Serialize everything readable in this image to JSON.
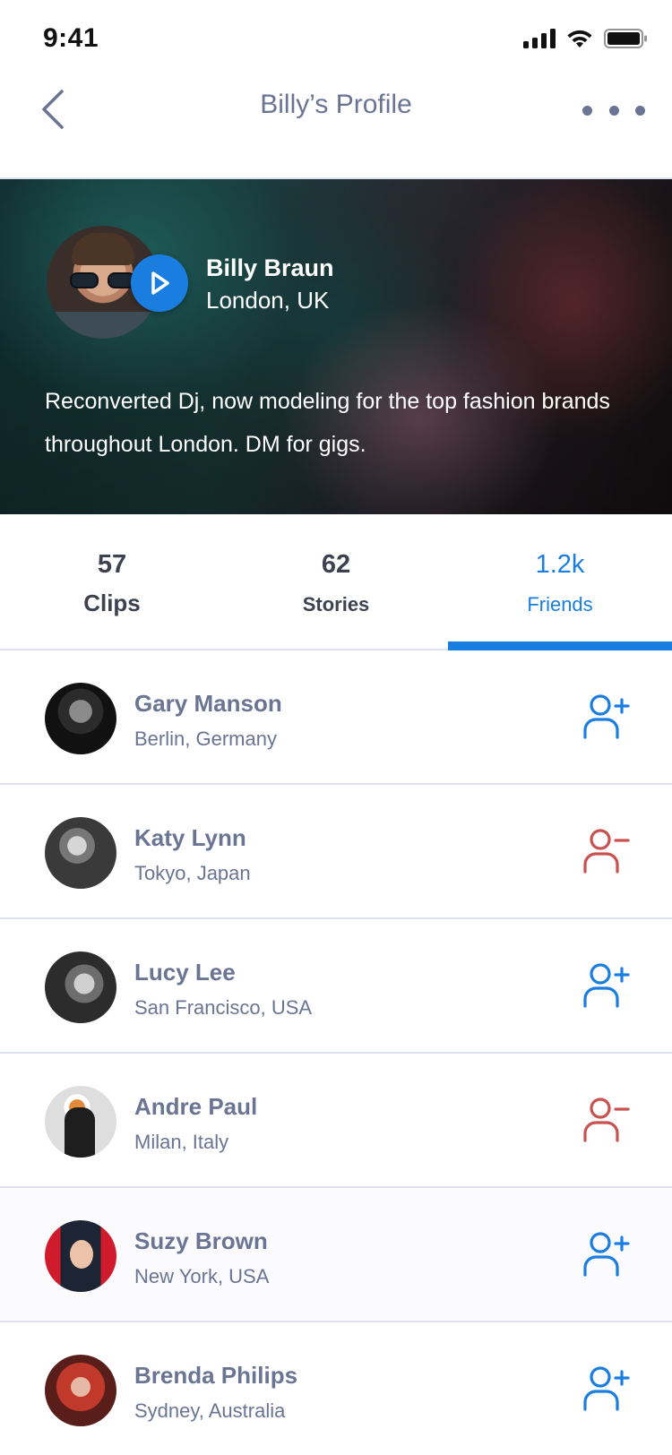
{
  "status_bar": {
    "time": "9:41",
    "icons": [
      "cellular-signal-icon",
      "wifi-icon",
      "battery-icon"
    ]
  },
  "nav": {
    "title": "Billy’s Profile",
    "back_icon": "chevron-left-icon",
    "more_icon": "more-horizontal-icon"
  },
  "profile": {
    "name": "Billy Braun",
    "location": "London, UK",
    "bio": "Reconverted Dj, now modeling for the top fashion brands throughout London. DM for gigs.",
    "play_icon": "play-icon"
  },
  "stats": [
    {
      "value": "57",
      "label": "Clips",
      "active": false
    },
    {
      "value": "62",
      "label": "Stories",
      "active": false
    },
    {
      "value": "1.2k",
      "label": "Friends",
      "active": true
    }
  ],
  "friends": [
    {
      "name": "Gary Manson",
      "location": "Berlin, Germany",
      "action": "add",
      "action_icon": "user-plus-icon",
      "action_color": "#1a7de0"
    },
    {
      "name": "Katy Lynn",
      "location": "Tokyo, Japan",
      "action": "remove",
      "action_icon": "user-minus-icon",
      "action_color": "#c9514f"
    },
    {
      "name": "Lucy Lee",
      "location": "San Francisco, USA",
      "action": "add",
      "action_icon": "user-plus-icon",
      "action_color": "#1a7de0"
    },
    {
      "name": "Andre Paul",
      "location": "Milan, Italy",
      "action": "remove",
      "action_icon": "user-minus-icon",
      "action_color": "#c9514f"
    },
    {
      "name": "Suzy Brown",
      "location": "New York, USA",
      "action": "add",
      "action_icon": "user-plus-icon",
      "action_color": "#1a7de0"
    },
    {
      "name": "Brenda Philips",
      "location": "Sydney, Australia",
      "action": "add",
      "action_icon": "user-plus-icon",
      "action_color": "#1a7de0"
    }
  ],
  "colors": {
    "accent": "#1a7de0",
    "remove": "#c9514f",
    "text_muted": "#6a7493",
    "text_dark": "#3e4250",
    "divider": "#dde3ee"
  }
}
